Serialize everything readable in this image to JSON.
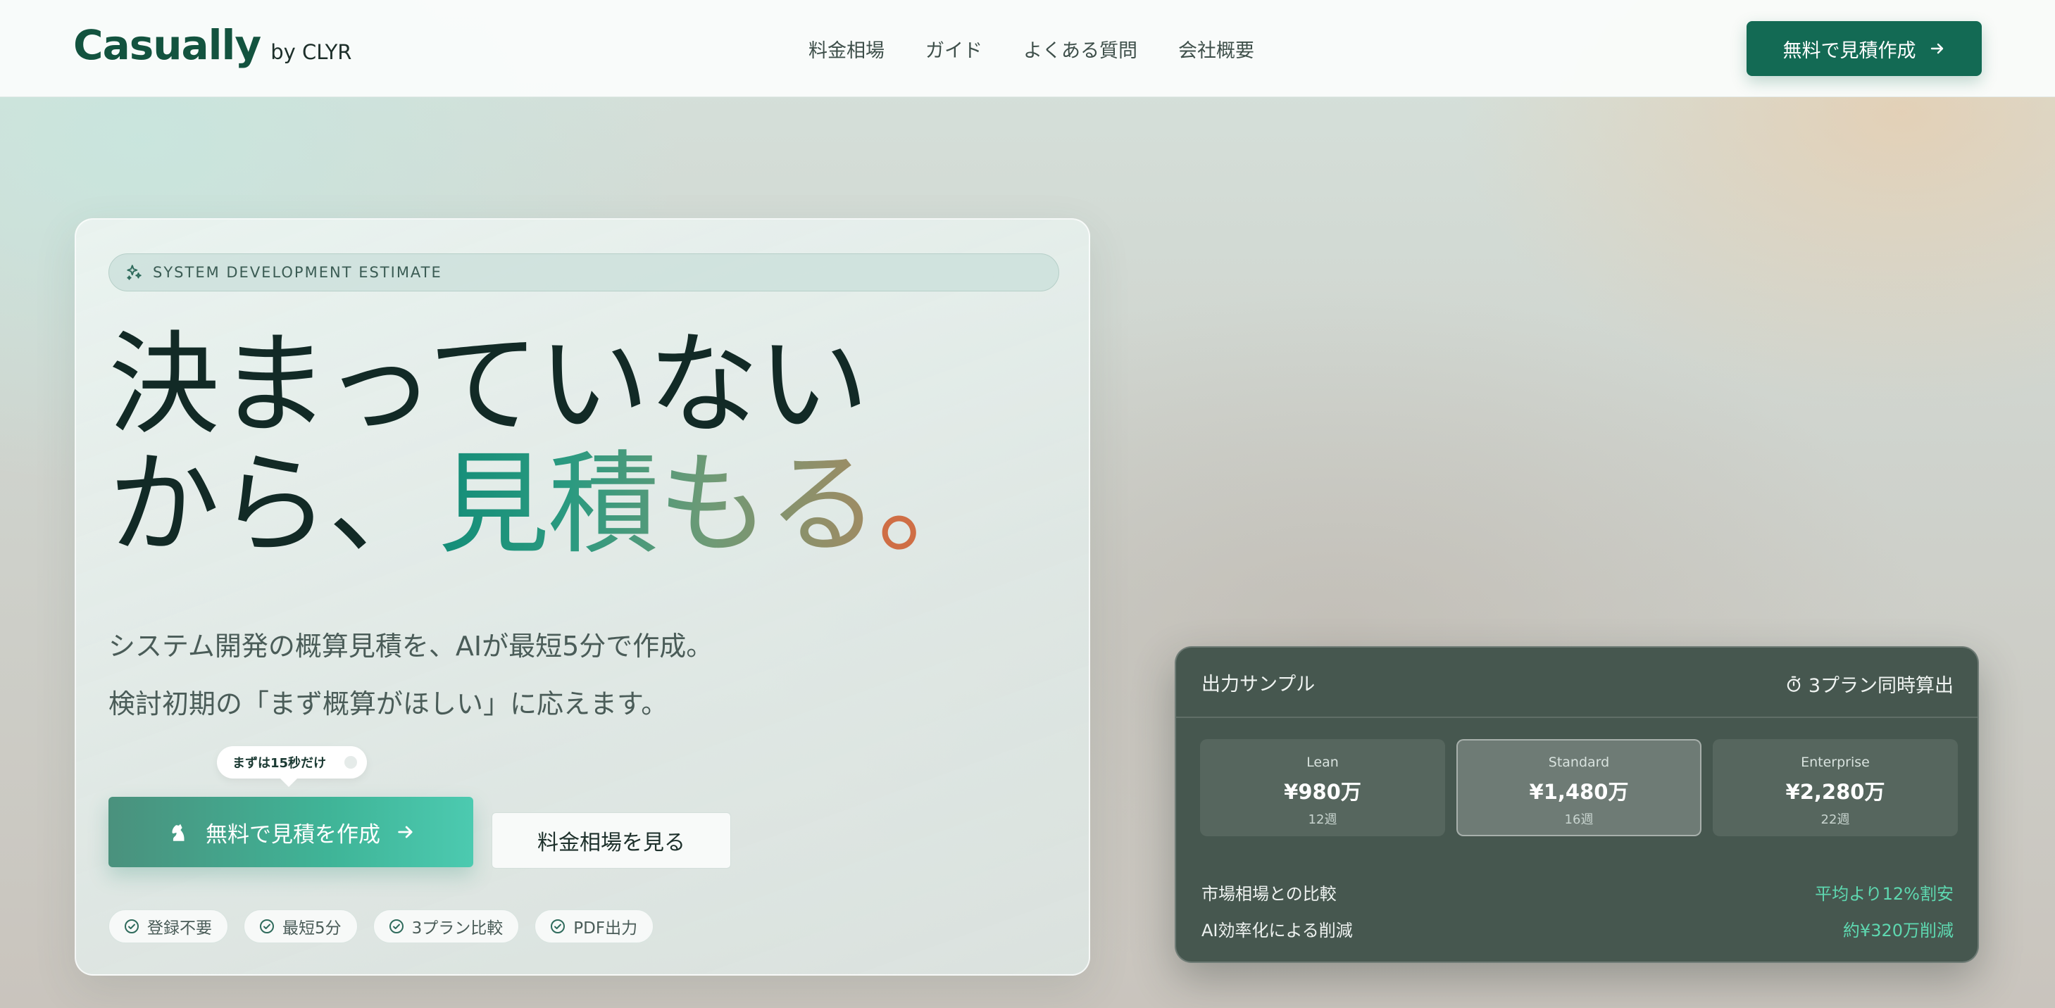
{
  "header": {
    "logo": "Casually",
    "logo_sub": "by CLYR",
    "nav": [
      "料金相場",
      "ガイド",
      "よくある質問",
      "会社概要"
    ],
    "cta": "無料で見積作成"
  },
  "hero": {
    "badge": "SYSTEM DEVELOPMENT ESTIMATE",
    "headline_line1": "決まっていない",
    "headline_line2_prefix": "から、",
    "headline_accent": "見積もる",
    "headline_dot": "。",
    "lead_line1": "システム開発の概算見積を、AIが最短5分で作成。",
    "lead_line2": "検討初期の「まず概算がほしい」に応えます。",
    "tooltip": "まずは15秒だけ",
    "primary_button": "無料で見積を作成",
    "secondary_button": "料金相場を見る",
    "chips": [
      "登録不要",
      "最短5分",
      "3プラン比較",
      "PDF出力"
    ]
  },
  "sample": {
    "title": "出力サンプル",
    "right_label": "3プラン同時算出",
    "plans": [
      {
        "name": "Lean",
        "price": "¥980万",
        "weeks": "12週"
      },
      {
        "name": "Standard",
        "price": "¥1,480万",
        "weeks": "16週"
      },
      {
        "name": "Enterprise",
        "price": "¥2,280万",
        "weeks": "22週"
      }
    ],
    "metrics": [
      {
        "label": "市場相場との比較",
        "value": "平均より12%割安"
      },
      {
        "label": "AI効率化による削減",
        "value": "約¥320万削減"
      }
    ]
  },
  "colors": {
    "brand": "#136a54",
    "accent_green": "#5ed8b0",
    "accent_orange": "#cf6e45"
  }
}
